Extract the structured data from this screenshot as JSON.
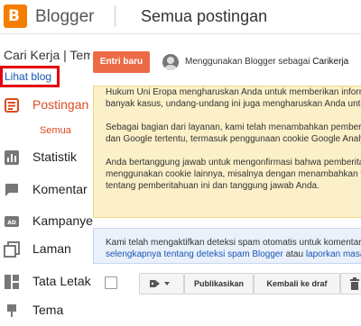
{
  "app": {
    "brand": "Blogger",
    "page_title": "Semua postingan"
  },
  "sidebar": {
    "blog_name": "Cari Kerja | Tempat Info Lowongan",
    "view_blog": "Lihat blog",
    "items": [
      {
        "label": "Postingan",
        "icon": "posts-icon",
        "active": true
      },
      {
        "label": "Statistik",
        "icon": "stats-icon",
        "active": false
      },
      {
        "label": "Komentar",
        "icon": "comment-icon",
        "active": false
      },
      {
        "label": "Kampanye",
        "icon": "campaign-icon",
        "active": false
      },
      {
        "label": "Laman",
        "icon": "pages-icon",
        "active": false
      },
      {
        "label": "Tata Letak",
        "icon": "layout-icon",
        "active": false
      },
      {
        "label": "Tema",
        "icon": "theme-icon",
        "active": false
      }
    ],
    "sub_item": "Semua"
  },
  "main": {
    "new_post": "Entri baru",
    "using_prefix": "Menggunakan Blogger sebagai ",
    "using_name": "Carikerja",
    "cookie_notice": [
      "Hukum Uni Eropa mengharuskan Anda untuk memberikan informasi kepada pengunjung",
      "banyak kasus, undang-undang ini juga mengharuskan Anda untuk mendapatkan persetujuan.",
      "Sebagai bagian dari layanan, kami telah menambahkan pemberitahuan di blog Anda",
      "dan Google tertentu, termasuk penggunaan cookie Google Analytics dan AdSense.",
      "Anda bertanggung jawab untuk mengonfirmasi bahwa pemberitahuan ini berfungsi",
      "menggunakan cookie lainnya, misalnya dengan menambahkan fitur pihak ketiga",
      "tentang pemberitahuan ini dan tanggung jawab Anda."
    ],
    "spam_notice": {
      "line1": "Kami telah mengaktifkan deteksi spam otomatis untuk komentar di blog Anda.",
      "link1": "selengkapnya tentang deteksi spam Blogger",
      "mid": " atau ",
      "link2": "laporkan masalah"
    },
    "toolbar": {
      "publish": "Publikasikan",
      "revert": "Kembali ke draf"
    }
  },
  "colors": {
    "accent": "#ec6a45",
    "brand": "#f57d00",
    "active_nav": "#dd4b1f",
    "highlight_border": "#e2000f",
    "link": "#1a56b4",
    "notice_bg": "#fcf0c8",
    "spam_bg": "#eaf1fb"
  }
}
